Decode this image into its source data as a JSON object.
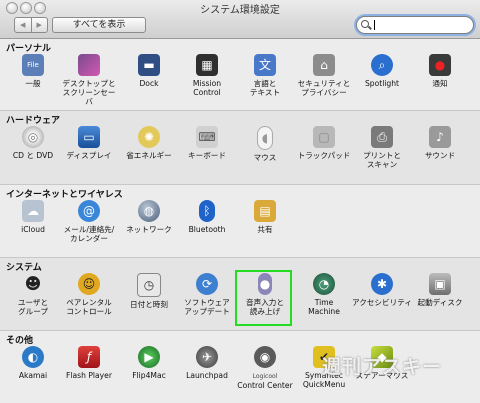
{
  "window": {
    "title": "システム環境設定",
    "show_all": "すべてを表示",
    "back": "◀",
    "forward": "▶",
    "search_value": ""
  },
  "sections": [
    {
      "title": "パーソナル",
      "items": [
        {
          "label": "一般",
          "icon": "general-icon",
          "glyph": "File",
          "color": "#5d7fb8"
        },
        {
          "label": "デスクトップと\nスクリーンセーバ",
          "icon": "desktop-screensaver-icon",
          "glyph": "",
          "color": "#7a4a8e"
        },
        {
          "label": "Dock",
          "icon": "dock-icon",
          "glyph": "▬",
          "color": "#2f4f84"
        },
        {
          "label": "Mission\nControl",
          "icon": "mission-control-icon",
          "glyph": "▦",
          "color": "#2f2f2f"
        },
        {
          "label": "言語と\nテキスト",
          "icon": "language-text-icon",
          "glyph": "文",
          "color": "#4a78c8"
        },
        {
          "label": "セキュリティと\nプライバシー",
          "icon": "security-house-icon",
          "glyph": "⌂",
          "color": "#8c8c8c"
        },
        {
          "label": "Spotlight",
          "icon": "spotlight-icon",
          "glyph": "⌕",
          "color": "#2a6fd0"
        },
        {
          "label": "通知",
          "icon": "notifications-icon",
          "glyph": "●",
          "color": "#3a3a3a"
        }
      ]
    },
    {
      "title": "ハードウェア",
      "items": [
        {
          "label": "CD と DVD",
          "icon": "cd-dvd-icon",
          "glyph": "◎",
          "color": "#b8b8b8"
        },
        {
          "label": "ディスプレイ",
          "icon": "display-icon",
          "glyph": "▭",
          "color": "#2d6fb8"
        },
        {
          "label": "省エネルギー",
          "icon": "energy-saver-bulb-icon",
          "glyph": "✺",
          "color": "#e3c85a"
        },
        {
          "label": "キーボード",
          "icon": "keyboard-icon",
          "glyph": "⌨",
          "color": "#9a9a9a"
        },
        {
          "label": "マウス",
          "icon": "mouse-icon",
          "glyph": "◖",
          "color": "#d8d8d8"
        },
        {
          "label": "トラックパッド",
          "icon": "trackpad-icon",
          "glyph": "▢",
          "color": "#a6a6a6"
        },
        {
          "label": "プリントと\nスキャン",
          "icon": "print-scan-icon",
          "glyph": "⎙",
          "color": "#7a7a7a"
        },
        {
          "label": "サウンド",
          "icon": "sound-icon",
          "glyph": "♪",
          "color": "#6f6f6f"
        }
      ]
    },
    {
      "title": "インターネットとワイヤレス",
      "items": [
        {
          "label": "iCloud",
          "icon": "icloud-icon",
          "glyph": "☁",
          "color": "#8aa0b8"
        },
        {
          "label": "メール/連絡先/\nカレンダー",
          "icon": "mail-contacts-icon",
          "glyph": "@",
          "color": "#3a86d8"
        },
        {
          "label": "ネットワーク",
          "icon": "network-globe-icon",
          "glyph": "◍",
          "color": "#6a7f9a"
        },
        {
          "label": "Bluetooth",
          "icon": "bluetooth-icon",
          "glyph": "ᛒ",
          "color": "#1f62c8"
        },
        {
          "label": "共有",
          "icon": "sharing-folder-icon",
          "glyph": "▤",
          "color": "#d9a93a"
        }
      ]
    },
    {
      "title": "システム",
      "items": [
        {
          "label": "ユーザと\nグループ",
          "icon": "users-groups-icon",
          "glyph": "👥",
          "color": "#333333"
        },
        {
          "label": "ペアレンタル\nコントロール",
          "icon": "parental-controls-icon",
          "glyph": "☺",
          "color": "#e0a820"
        },
        {
          "label": "日付と時刻",
          "icon": "date-time-icon",
          "glyph": "◷",
          "color": "#8e8e8e"
        },
        {
          "label": "ソフトウェア\nアップデート",
          "icon": "software-update-icon",
          "glyph": "⟳",
          "color": "#3d7fd0"
        },
        {
          "label": "音声入力と\n読み上げ",
          "icon": "dictation-speech-icon",
          "glyph": "🎙",
          "color": "#8a86b8"
        },
        {
          "label": "Time\nMachine",
          "icon": "time-machine-icon",
          "glyph": "◔",
          "color": "#2f7a5a"
        },
        {
          "label": "アクセシビリティ",
          "icon": "accessibility-icon",
          "glyph": "♿",
          "color": "#2a6fd0"
        },
        {
          "label": "起動ディスク",
          "icon": "startup-disk-icon",
          "glyph": "▣",
          "color": "#7e7e7e"
        }
      ]
    },
    {
      "title": "その他",
      "items": [
        {
          "label": "Akamai",
          "icon": "akamai-icon",
          "glyph": "◐",
          "color": "#2b7ac8"
        },
        {
          "label": "Flash Player",
          "icon": "flash-player-icon",
          "glyph": "ƒ",
          "color": "#c8221f"
        },
        {
          "label": "Flip4Mac",
          "icon": "flip4mac-icon",
          "glyph": "▶",
          "color": "#2e9a3a"
        },
        {
          "label": "Launchpad",
          "icon": "launchpad-icon",
          "glyph": "✈",
          "color": "#5a5a5a"
        },
        {
          "label": "Control Center",
          "icon": "logicool-control-center-icon",
          "glyph": "◉",
          "color": "#5a5a5a",
          "sublabel": "Logicool"
        },
        {
          "label": "Symantec\nQuickMenu",
          "icon": "symantec-quickmenu-icon",
          "glyph": "✔",
          "color": "#e0c020"
        },
        {
          "label": "ステアーマウス",
          "icon": "steermouse-icon",
          "glyph": "◆",
          "color": "#8ab020"
        }
      ]
    }
  ],
  "watermark": "週刊アスキー"
}
